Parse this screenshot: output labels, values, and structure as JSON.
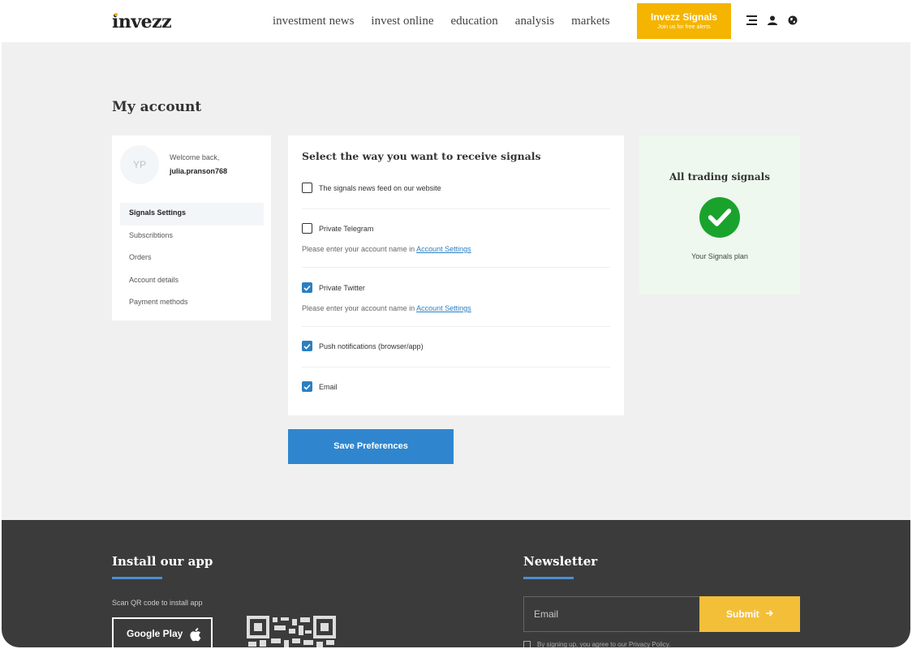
{
  "header": {
    "logo": "invezz",
    "nav": [
      "investment news",
      "invest online",
      "education",
      "analysis",
      "markets"
    ],
    "signals_button": {
      "title": "Invezz Signals",
      "subtitle": "Join us for free alerts"
    },
    "icons": [
      "menu-icon",
      "user-icon",
      "globe-icon"
    ]
  },
  "page": {
    "title": "My account"
  },
  "sidebar": {
    "avatar_initials": "YP",
    "welcome": "Welcome back,",
    "username": "julia.pranson768",
    "menu": [
      "Signals Settings",
      "Subscribtions",
      "Orders",
      "Account details",
      "Payment methods"
    ],
    "active_index": 0
  },
  "signals": {
    "title": "Select the way you want to receive signals",
    "options": [
      {
        "label": "The signals news feed on our website",
        "checked": false
      },
      {
        "label": "Private Telegram",
        "checked": false
      },
      {
        "label": "Private Twitter",
        "checked": true
      },
      {
        "label": "Push notifications (browser/app)",
        "checked": true
      },
      {
        "label": "Email",
        "checked": true
      }
    ],
    "note_prefix": "Please enter your account name in",
    "note_link": "Account Settings",
    "save_label": "Save Preferences"
  },
  "plan": {
    "title": "All trading signals",
    "subtitle": "Your Signals plan",
    "check_color": "#1aa32c"
  },
  "footer": {
    "app_title": "Install our app",
    "scan_text": "Scan QR code to install app",
    "google_play": "Google Play",
    "newsletter_title": "Newsletter",
    "email_placeholder": "Email",
    "submit_label": "Submit",
    "consent": "By signing up, you agree to our Privacy Policy."
  },
  "colors": {
    "accent_blue": "#2f86cf",
    "accent_yellow": "#f4b400",
    "footer_bg": "#3b3b3b"
  }
}
